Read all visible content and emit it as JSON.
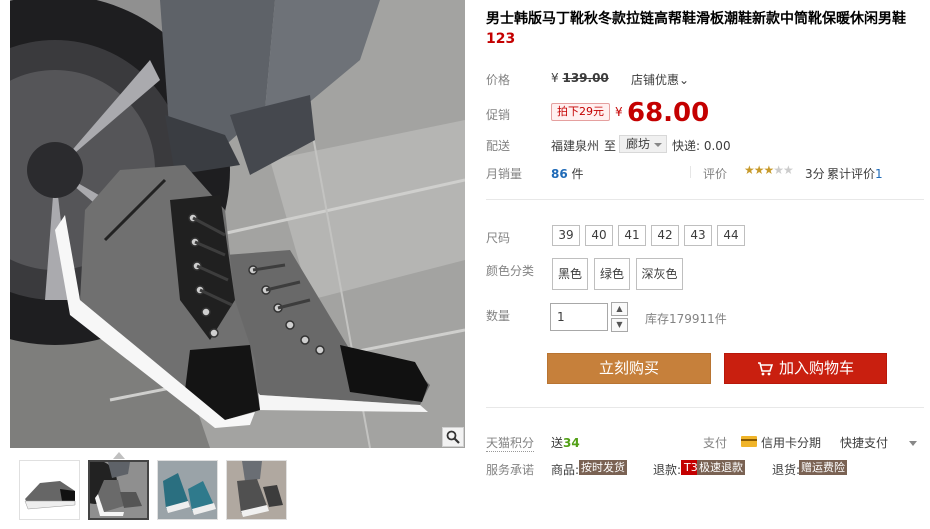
{
  "product": {
    "title": "男士韩版马丁靴秋冬款拉链高帮鞋滑板潮鞋新款中筒靴保暖休闲男鞋",
    "title_num": "123"
  },
  "price": {
    "label": "价格",
    "currency": "¥",
    "original": "139.00",
    "store_promo": "店铺优惠⌄"
  },
  "promo": {
    "label": "促销",
    "tag": "拍下29元",
    "currency": "¥",
    "price": "68.00"
  },
  "shipping": {
    "label": "配送",
    "from": "福建泉州",
    "to": "至",
    "destination": "廊坊",
    "fee": "快递: 0.00"
  },
  "sales": {
    "label": "月销量",
    "count": "86",
    "unit": "件",
    "rating_label": "评价",
    "stars_on": "★★★",
    "stars_off": "★★",
    "rating": 3,
    "score": "3分",
    "reviews_prefix": "累计评价",
    "reviews_count": "1"
  },
  "size": {
    "label": "尺码",
    "options": [
      "39",
      "40",
      "41",
      "42",
      "43",
      "44"
    ]
  },
  "color": {
    "label": "颜色分类",
    "options": [
      "黑色",
      "绿色",
      "深灰色"
    ]
  },
  "quantity": {
    "label": "数量",
    "value": "1",
    "up": "▲",
    "down": "▼",
    "stock": "库存179911件"
  },
  "buttons": {
    "buy": "立刻购买",
    "cart": "加入购物车"
  },
  "points": {
    "label": "天猫积分",
    "prefix": "送",
    "value": "34"
  },
  "payment": {
    "label": "支付",
    "card": "信用卡分期",
    "quick": "快捷支付"
  },
  "commitment": {
    "label": "服务承诺",
    "goods_label": "商品:",
    "goods_tag": "按时发货",
    "refund_label": "退款:",
    "refund_t3": "T3",
    "refund_tag": "极速退款",
    "return_label": "退货:",
    "return_tag": "赠运费险"
  },
  "colors": {
    "price_red": "#c40000",
    "buy_orange": "#c6803b",
    "cart_red": "#c91f0f",
    "link_blue": "#1f6ab7",
    "points_green": "#53a017",
    "tag_brown": "#7a6253"
  },
  "icons": [
    "zoom-icon",
    "cart-icon",
    "credit-card-icon",
    "chevron-down-icon"
  ]
}
